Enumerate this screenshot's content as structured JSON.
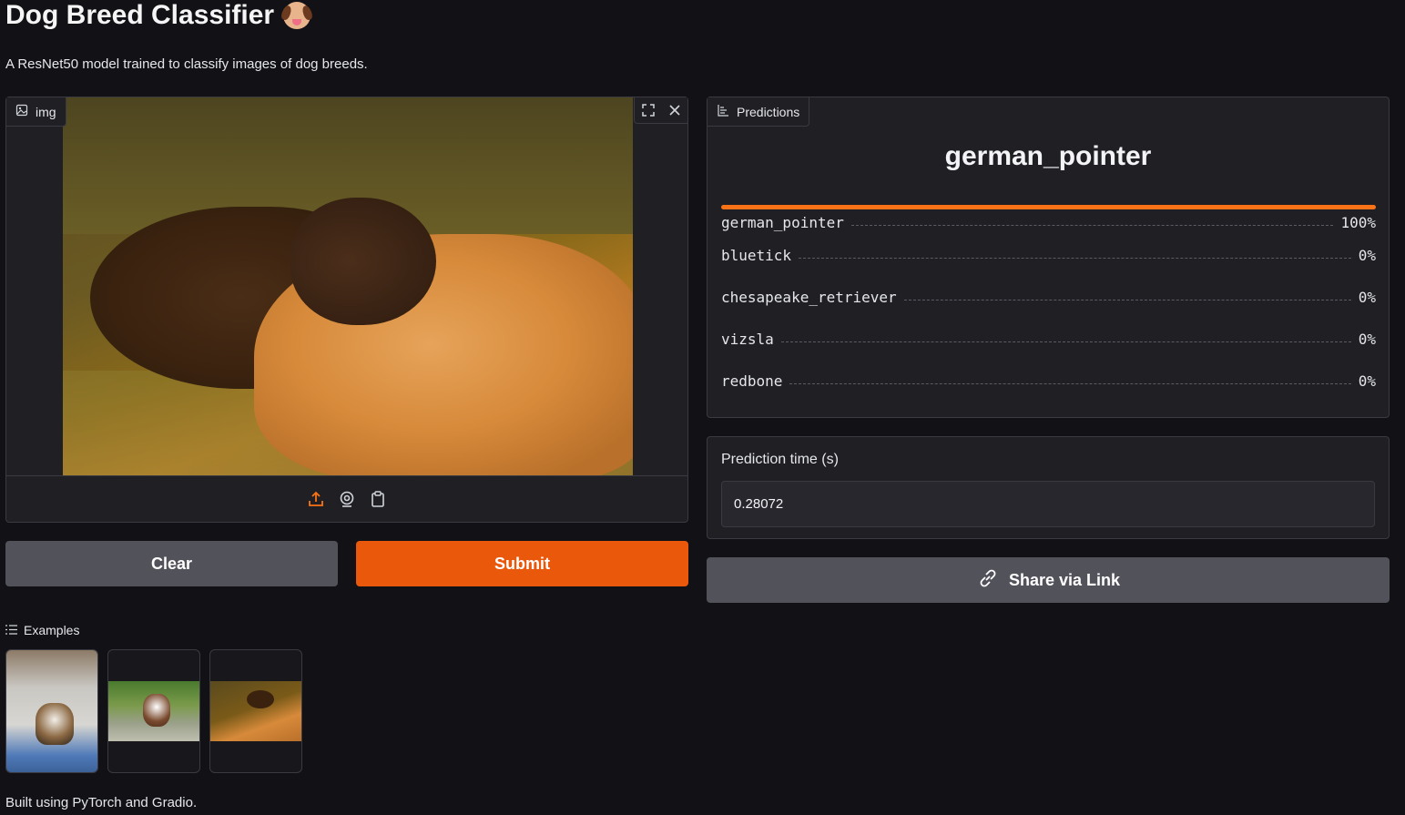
{
  "app": {
    "title": "Dog Breed Classifier",
    "description": "A ResNet50 model trained to classify images of dog breeds.",
    "footer": "Built using PyTorch and Gradio."
  },
  "image_input": {
    "label": "img",
    "icons": [
      "image-icon",
      "fullscreen-icon",
      "close-icon",
      "upload-icon",
      "webcam-icon",
      "clipboard-icon"
    ]
  },
  "buttons": {
    "clear": "Clear",
    "submit": "Submit",
    "share": "Share via Link"
  },
  "predictions": {
    "label": "Predictions",
    "top_label": "german_pointer",
    "confidences": [
      {
        "label": "german_pointer",
        "value": "100%",
        "fraction": 1.0
      },
      {
        "label": "bluetick",
        "value": "0%",
        "fraction": 0.0
      },
      {
        "label": "chesapeake_retriever",
        "value": "0%",
        "fraction": 0.0
      },
      {
        "label": "vizsla",
        "value": "0%",
        "fraction": 0.0
      },
      {
        "label": "redbone",
        "value": "0%",
        "fraction": 0.0
      }
    ]
  },
  "prediction_time": {
    "label": "Prediction time (s)",
    "value": "0.28072"
  },
  "examples": {
    "label": "Examples"
  },
  "colors": {
    "accent": "#ea580c",
    "bar": "#f97316",
    "secondary_button": "#52525b",
    "background": "#111116"
  }
}
